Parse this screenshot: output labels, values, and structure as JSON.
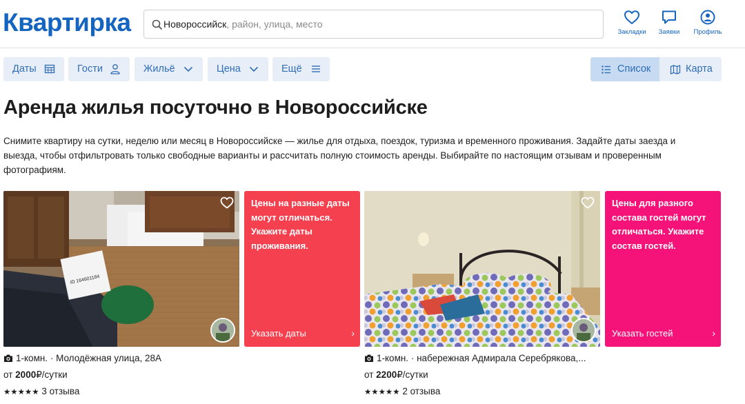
{
  "header": {
    "logo": "Квартирка",
    "search": {
      "value": "Новороссийск",
      "hint": ", район, улица, место"
    },
    "buttons": [
      {
        "label": "Закладки",
        "icon": "heart-icon"
      },
      {
        "label": "Заявки",
        "icon": "chat-icon"
      },
      {
        "label": "Профиль",
        "icon": "user-icon"
      }
    ]
  },
  "filters": {
    "dates": "Даты",
    "guests": "Гости",
    "housing": "Жильё",
    "price": "Цена",
    "more": "Ещё"
  },
  "view": {
    "list": "Список",
    "map": "Карта",
    "active": "list"
  },
  "page": {
    "title": "Аренда жилья посуточно в Новороссийске",
    "intro": "Снимите квартиру на сутки, неделю или месяц в Новороссийске — жилье для отдыха, поездок, туризма и временного проживания. Задайте даты заезда и выезда, чтобы отфильтровать только свободные варианты и рассчитать полную стоимость аренды. Выбирайте по настоящим отзывам и проверенным фотографиям."
  },
  "listings": [
    {
      "rooms": "1-комн.",
      "address": "Молодёжная улица, 28А",
      "price_prefix": "от",
      "price": "2000",
      "price_suffix": "₽/сутки",
      "stars": "★★★★★",
      "reviews": "3 отзыва",
      "photo_label": "ID 164601184"
    },
    {
      "rooms": "1-комн.",
      "address": "набережная Адмирала Серебрякова,...",
      "price_prefix": "от",
      "price": "2200",
      "price_suffix": "₽/сутки",
      "stars": "★★★★★",
      "reviews": "2 отзыва"
    }
  ],
  "promos": [
    {
      "text": "Цены на разные даты могут отличаться. Укажите даты проживания.",
      "link": "Указать даты",
      "arrow": "›",
      "color": "#f4404f"
    },
    {
      "text": "Цены для разного состава гостей могут отличаться. Укажите состав гостей.",
      "link": "Указать гостей",
      "arrow": "›",
      "color": "#f5137a"
    }
  ],
  "colors": {
    "brand": "#1565c0",
    "filter_bg": "#e8eef7",
    "filter_text": "#2f6db5",
    "active_toggle": "#c6daf2"
  }
}
